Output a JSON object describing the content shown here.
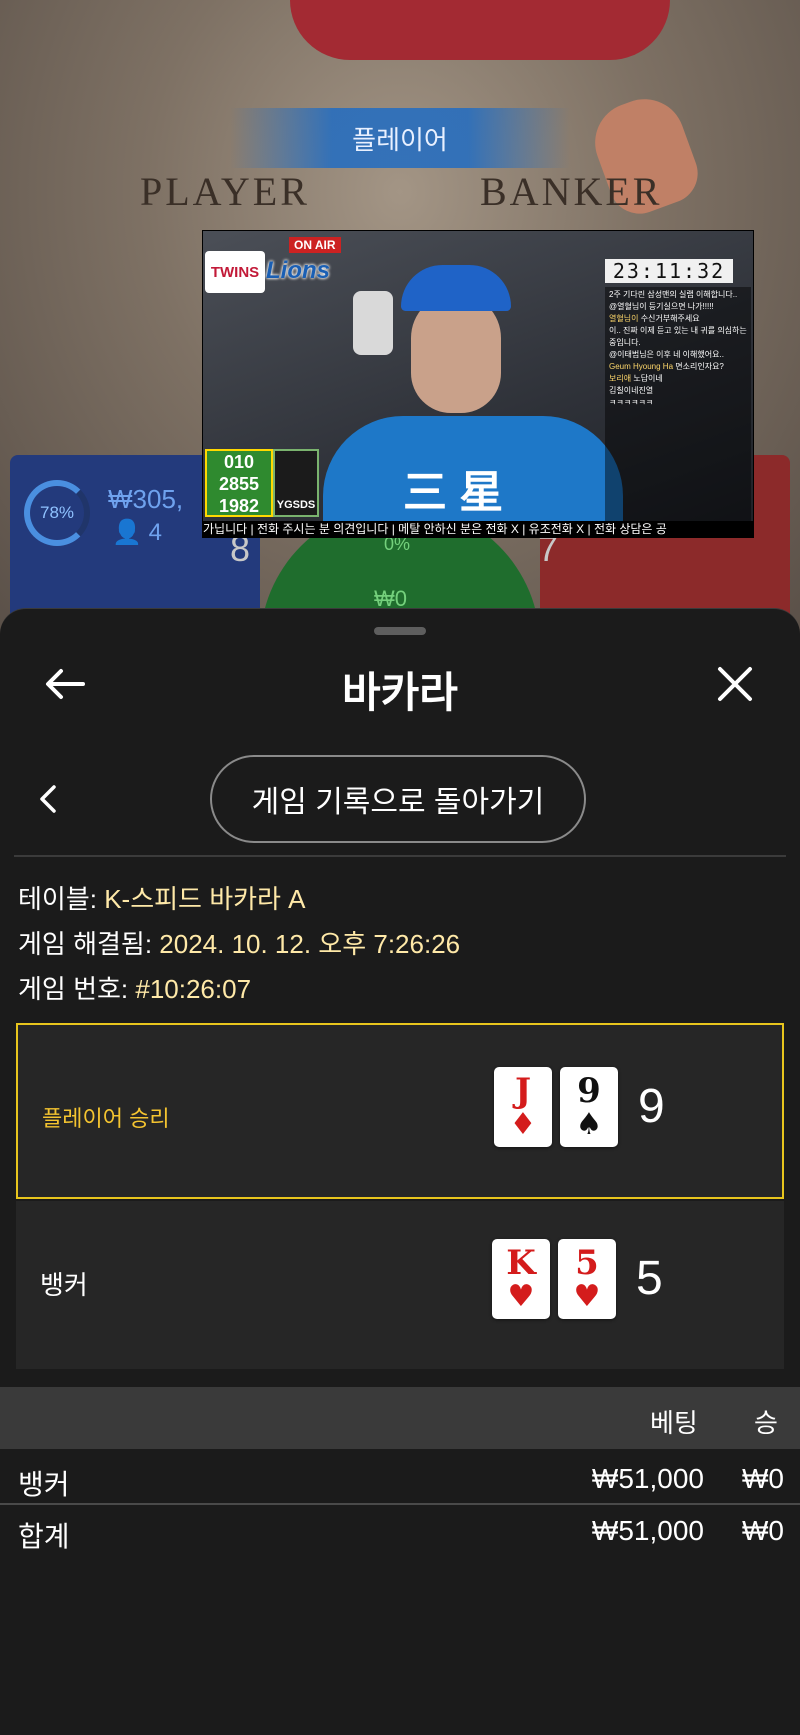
{
  "background": {
    "player_banner": "플레이어",
    "felt_player": "PLAYER",
    "felt_banker": "BANKER",
    "player_percent": "78%",
    "player_pool": "₩305,",
    "player_count": "4",
    "player_side_score": "8",
    "banker_side_score": "7",
    "tie_percent": "0%",
    "tie_amount": "₩0"
  },
  "video": {
    "on_air": "ON AIR",
    "logo_twins": "TWINS",
    "logo_lions": "Lions",
    "jersey_text": "三 星",
    "clock": "23:11:32",
    "chat": [
      {
        "name": "",
        "text": "2주 기다린 삼성맨의 실랩 이해합니다.."
      },
      {
        "name": "",
        "text": "@열혈님이 등기실으면 나가!!!!!"
      },
      {
        "name": "열혈님이",
        "text": "수신거부해주세요"
      },
      {
        "name": "",
        "text": "이.. 진짜 이제 듣고 있는 내 귀를 의심하는"
      },
      {
        "name": "",
        "text": "중입니다."
      },
      {
        "name": "",
        "text": "@이태범님은 이후 네 이해했어요.."
      },
      {
        "name": "Geum Hyoung Ha",
        "text": "면소리인자요?"
      },
      {
        "name": "보리애",
        "text": "노답이네"
      },
      {
        "name": "",
        "text": "김칠이네진열"
      },
      {
        "name": "",
        "text": "ㅋㅋㅋㅋㅋㅋ"
      }
    ],
    "score_lines": [
      "010",
      "2855",
      "1982"
    ],
    "ygsds": "YGSDS",
    "ticker": "가닙니다 | 전화 주시는 분 의견입니다 | 메탈 안하신 분은 전화 X | 유조전화 X | 전화 상담은 공"
  },
  "sheet": {
    "title": "바카라",
    "back_to_history": "게임 기록으로 돌아가기",
    "info": {
      "table_label": "테이블: ",
      "table_value": "K-스피드 바카라 A",
      "resolved_label": "게임 해결됨: ",
      "resolved_value": "2024. 10. 12. 오후 7:26:26",
      "number_label": "게임 번호: ",
      "number_value": "#10:26:07"
    },
    "player_result": {
      "label": "플레이어 승리",
      "cards": [
        {
          "rank": "J",
          "suit": "♦",
          "color": "#d41c1c"
        },
        {
          "rank": "9",
          "suit": "♠",
          "color": "#111111"
        }
      ],
      "score": "9"
    },
    "banker_result": {
      "label": "뱅커",
      "cards": [
        {
          "rank": "K",
          "suit": "♥",
          "color": "#d41c1c"
        },
        {
          "rank": "5",
          "suit": "♥",
          "color": "#d41c1c"
        }
      ],
      "score": "5"
    },
    "table": {
      "columns": [
        "베팅",
        "승"
      ],
      "rows": [
        {
          "name": "뱅커",
          "bet": "₩51,000",
          "win": "₩0"
        },
        {
          "name": "합계",
          "bet": "₩51,000",
          "win": "₩0"
        }
      ]
    }
  },
  "colors": {
    "win_border": "#e8c51d",
    "win_label": "#f4c430",
    "info_value": "#ffe9a8"
  }
}
